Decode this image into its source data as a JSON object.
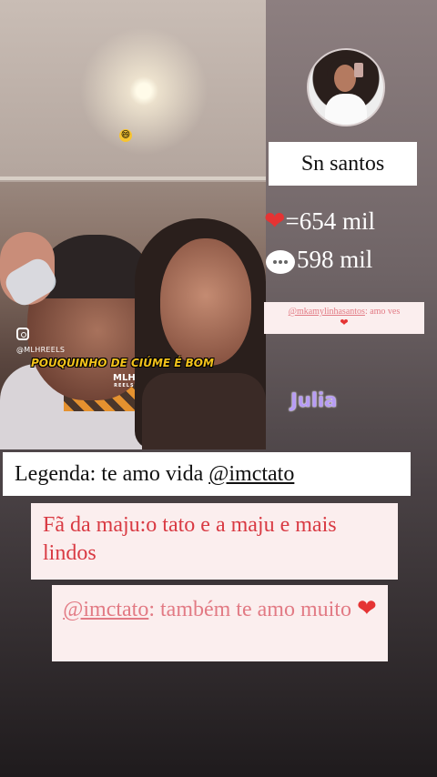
{
  "video": {
    "watermark_handle": "@MLHREELS",
    "caption": "POUQUINHO DE CIÚME É BOM",
    "logo": "MLH",
    "logo_sub": "REELS",
    "emoji": "😄"
  },
  "profile": {
    "name": "Sn santos"
  },
  "stats": {
    "likes_icon": "heart-icon",
    "likes": "=654 mil",
    "comments_icon": "comment-bubble-icon",
    "comments": "598 mil"
  },
  "small_comment": {
    "handle": "@mkamylinhasantos",
    "text": ": amo ves"
  },
  "tag_label": "Julia",
  "legend": {
    "prefix": "Legenda: te amo vida ",
    "handle": "@imctato"
  },
  "fan_comment": {
    "text": "Fã da maju:o tato e a maju e mais lindos"
  },
  "reply": {
    "handle": "@imctato",
    "text": ": também te amo muito"
  },
  "colors": {
    "heart": "#e53333",
    "comment_text": "#e27a84",
    "fan_text": "#d93a43",
    "julia": "#b79cf5",
    "caption": "#f2c21b"
  }
}
